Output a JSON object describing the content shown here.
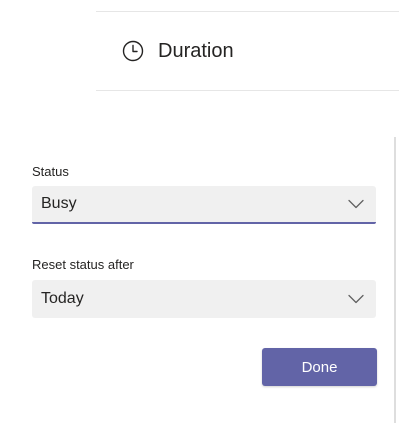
{
  "duration": {
    "label": "Duration",
    "icon": "clock-icon"
  },
  "status": {
    "label": "Status",
    "value": "Busy",
    "icon": "chevron-down-icon"
  },
  "reset": {
    "label": "Reset status after",
    "value": "Today",
    "icon": "chevron-down-icon"
  },
  "actions": {
    "done_label": "Done"
  },
  "colors": {
    "accent": "#6264a7",
    "field_background": "#f0f0f0",
    "text": "#252423"
  }
}
